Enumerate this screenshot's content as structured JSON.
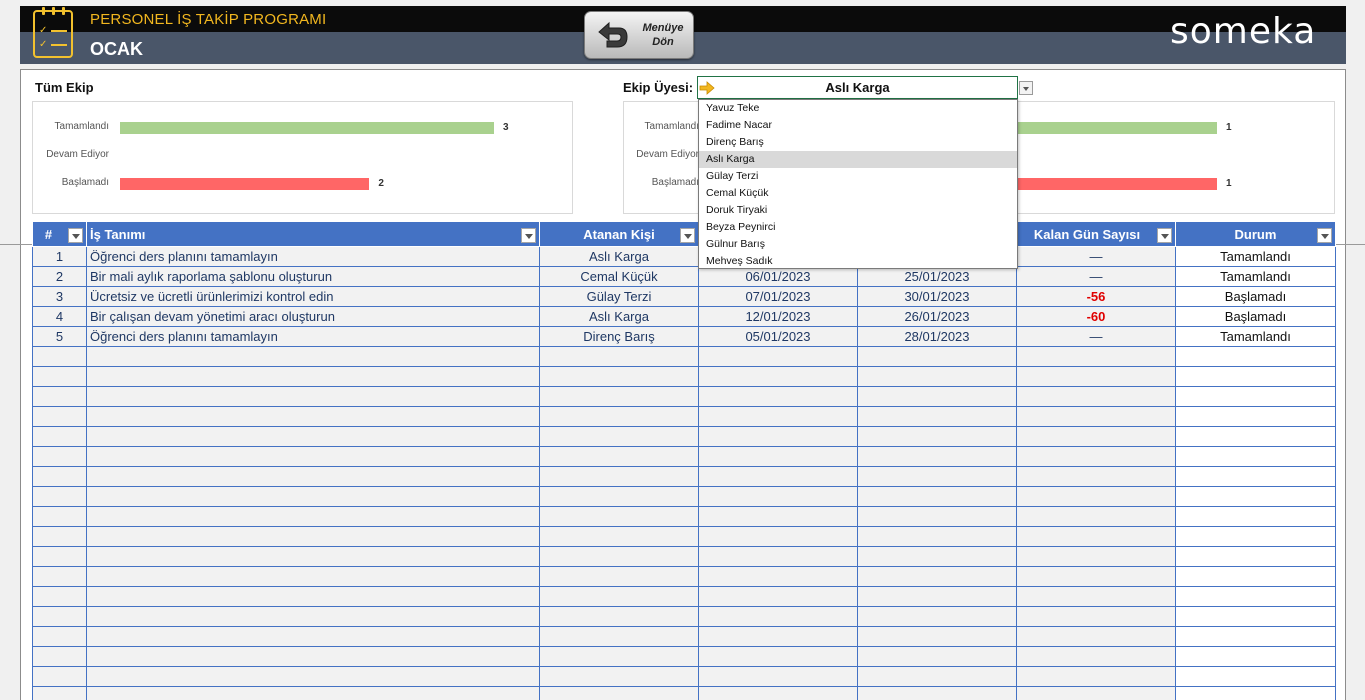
{
  "header": {
    "app_title": "PERSONEL İŞ TAKİP PROGRAMI",
    "month": "OCAK",
    "menu_button_line1": "Menüye",
    "menu_button_line2": "Dön",
    "brand": "someka"
  },
  "team_chart": {
    "section_label": "Tüm Ekip",
    "rows": [
      {
        "label": "Tamamlandı",
        "value": 3,
        "color": "#a9d18e"
      },
      {
        "label": "Devam Ediyor",
        "value": 0,
        "color": "#ffd966"
      },
      {
        "label": "Başlamadı",
        "value": 2,
        "color": "#ff6666"
      }
    ]
  },
  "member_chart": {
    "section_label": "Ekip Üyesi:",
    "selected_member": "Aslı Karga",
    "rows": [
      {
        "label": "Tamamlandı",
        "value": 1,
        "color": "#a9d18e"
      },
      {
        "label": "Devam Ediyor",
        "value": 0,
        "color": "#ffd966"
      },
      {
        "label": "Başlamadı",
        "value": 1,
        "color": "#ff6666"
      }
    ]
  },
  "dropdown": {
    "options": [
      "Yavuz Teke",
      "Fadime Nacar",
      "Direnç Barış",
      "Aslı Karga",
      "Gülay Terzi",
      "Cemal Küçük",
      "Doruk Tiryaki",
      "Beyza Peynirci",
      "Gülnur Barış",
      "Mehveş Sadık"
    ],
    "selected": "Aslı Karga"
  },
  "table": {
    "headers": {
      "num": "#",
      "desc": "İş Tanımı",
      "assignee": "Atanan Kişi",
      "remaining": "Kalan Gün Sayısı",
      "status": "Durum"
    },
    "rows": [
      {
        "num": "1",
        "desc": "Öğrenci ders planını tamamlayın",
        "assignee": "Aslı Karga",
        "start": "",
        "end": "",
        "remaining": "—",
        "status": "Tamamlandı"
      },
      {
        "num": "2",
        "desc": "Bir mali aylık raporlama şablonu oluşturun",
        "assignee": "Cemal Küçük",
        "start": "06/01/2023",
        "end": "25/01/2023",
        "remaining": "—",
        "status": "Tamamlandı"
      },
      {
        "num": "3",
        "desc": "Ücretsiz ve ücretli ürünlerimizi kontrol edin",
        "assignee": "Gülay Terzi",
        "start": "07/01/2023",
        "end": "30/01/2023",
        "remaining": "-56",
        "status": "Başlamadı"
      },
      {
        "num": "4",
        "desc": "Bir çalışan devam yönetimi aracı oluşturun",
        "assignee": "Aslı Karga",
        "start": "12/01/2023",
        "end": "26/01/2023",
        "remaining": "-60",
        "status": "Başlamadı"
      },
      {
        "num": "5",
        "desc": "Öğrenci ders planını tamamlayın",
        "assignee": "Direnç Barış",
        "start": "05/01/2023",
        "end": "28/01/2023",
        "remaining": "—",
        "status": "Tamamlandı"
      }
    ],
    "empty_rows": 18
  },
  "colors": {
    "header_blue": "#4472c4",
    "accent_gold": "#f2b71f",
    "negative": "#e00000"
  }
}
